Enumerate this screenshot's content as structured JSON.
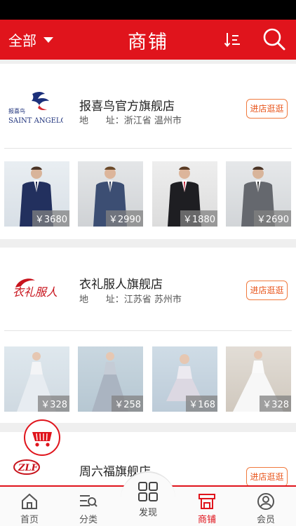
{
  "header": {
    "category_label": "全部",
    "title": "商铺",
    "sort_icon": "sort-icon",
    "search_icon": "search-icon"
  },
  "shops": [
    {
      "name": "报喜鸟官方旗舰店",
      "logo_text_cn": "报喜鸟",
      "logo_text_en": "SAINT ANGELO",
      "address": "地      址：浙江省 温州市",
      "enter_label": "进店逛逛",
      "products": [
        {
          "price": "￥3680"
        },
        {
          "price": "￥2990"
        },
        {
          "price": "￥1880"
        },
        {
          "price": "￥2690"
        }
      ]
    },
    {
      "name": "衣礼服人旗舰店",
      "logo_text_cn": "衣礼服人",
      "address": "地      址：江苏省 苏州市",
      "enter_label": "进店逛逛",
      "products": [
        {
          "price": "￥328"
        },
        {
          "price": "￥258"
        },
        {
          "price": "￥168"
        },
        {
          "price": "￥328"
        }
      ]
    },
    {
      "name": "周六福旗舰店",
      "logo_text_en": "ZLF",
      "enter_label": "进店逛逛"
    }
  ],
  "tabbar": {
    "items": [
      {
        "label": "首页",
        "icon": "home-icon"
      },
      {
        "label": "分类",
        "icon": "category-icon"
      },
      {
        "label": "发现",
        "icon": "grid-icon"
      },
      {
        "label": "商铺",
        "icon": "shop-icon",
        "active": true
      },
      {
        "label": "会员",
        "icon": "user-icon"
      }
    ]
  },
  "colors": {
    "brand_red": "#e0141c",
    "enter_orange": "#e8541a"
  }
}
